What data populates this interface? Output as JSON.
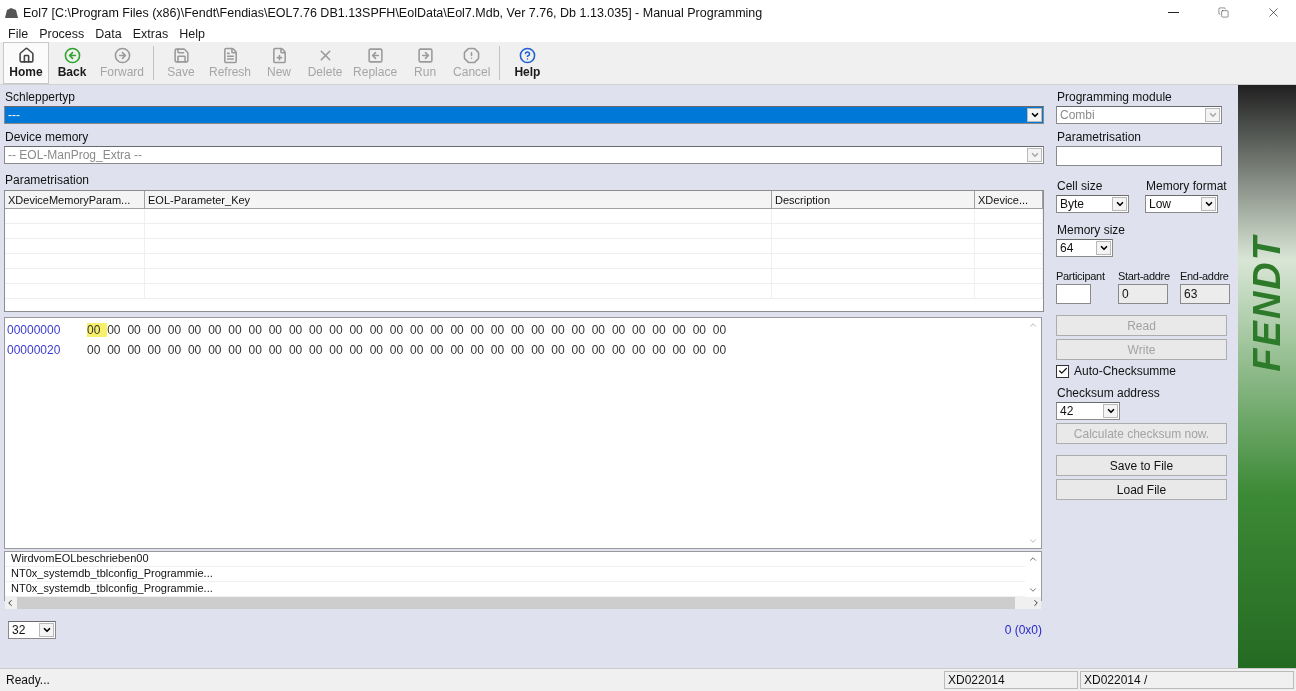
{
  "window": {
    "title": "Eol7 [C:\\Program Files (x86)\\Fendt\\Fendias\\EOL7.76 DB1.13SPFH\\EolData\\Eol7.Mdb, Ver 7.76, Db 1.13.035]  - Manual Programming"
  },
  "menu": [
    "File",
    "Process",
    "Data",
    "Extras",
    "Help"
  ],
  "toolbar": {
    "groups": [
      {
        "buttons": [
          {
            "label": "Home",
            "kind": "home",
            "disabled": false,
            "selected": true
          },
          {
            "label": "Back",
            "kind": "back",
            "disabled": false,
            "selected": false
          },
          {
            "label": "Forward",
            "kind": "forward",
            "disabled": true,
            "selected": false
          }
        ]
      },
      {
        "buttons": [
          {
            "label": "Save",
            "kind": "save",
            "disabled": true,
            "selected": false
          },
          {
            "label": "Refresh",
            "kind": "refresh",
            "disabled": true,
            "selected": false
          },
          {
            "label": "New",
            "kind": "new",
            "disabled": true,
            "selected": false
          },
          {
            "label": "Delete",
            "kind": "delete",
            "disabled": true,
            "selected": false
          },
          {
            "label": "Replace",
            "kind": "replace",
            "disabled": true,
            "selected": false
          },
          {
            "label": "Run",
            "kind": "run",
            "disabled": true,
            "selected": false
          },
          {
            "label": "Cancel",
            "kind": "cancel",
            "disabled": true,
            "selected": false
          }
        ]
      },
      {
        "buttons": [
          {
            "label": "Help",
            "kind": "help",
            "disabled": false,
            "selected": false
          }
        ]
      }
    ]
  },
  "schleppertyp": {
    "label": "Schleppertyp",
    "value": "---",
    "selected": true
  },
  "device_memory": {
    "label": "Device memory",
    "value": "-- EOL-ManProg_Extra --",
    "disabled": true
  },
  "parametrisation": {
    "label": "Parametrisation",
    "columns": [
      "XDeviceMemoryParam...",
      "EOL-Parameter_Key",
      "Description",
      "XDevice..."
    ]
  },
  "hex_rows": [
    {
      "address": "00000000",
      "bytes": [
        {
          "value": "00",
          "selected": true
        },
        {
          "value": "00",
          "selected": false
        },
        {
          "value": "00",
          "selected": false
        },
        {
          "value": "00",
          "selected": false
        },
        {
          "value": "00",
          "selected": false
        },
        {
          "value": "00",
          "selected": false
        },
        {
          "value": "00",
          "selected": false
        },
        {
          "value": "00",
          "selected": false
        },
        {
          "value": "00",
          "selected": false
        },
        {
          "value": "00",
          "selected": false
        },
        {
          "value": "00",
          "selected": false
        },
        {
          "value": "00",
          "selected": false
        },
        {
          "value": "00",
          "selected": false
        },
        {
          "value": "00",
          "selected": false
        },
        {
          "value": "00",
          "selected": false
        },
        {
          "value": "00",
          "selected": false
        },
        {
          "value": "00",
          "selected": false
        },
        {
          "value": "00",
          "selected": false
        },
        {
          "value": "00",
          "selected": false
        },
        {
          "value": "00",
          "selected": false
        },
        {
          "value": "00",
          "selected": false
        },
        {
          "value": "00",
          "selected": false
        },
        {
          "value": "00",
          "selected": false
        },
        {
          "value": "00",
          "selected": false
        },
        {
          "value": "00",
          "selected": false
        },
        {
          "value": "00",
          "selected": false
        },
        {
          "value": "00",
          "selected": false
        },
        {
          "value": "00",
          "selected": false
        },
        {
          "value": "00",
          "selected": false
        },
        {
          "value": "00",
          "selected": false
        },
        {
          "value": "00",
          "selected": false
        },
        {
          "value": "00",
          "selected": false
        }
      ]
    },
    {
      "address": "00000020",
      "bytes": [
        {
          "value": "00",
          "selected": false
        },
        {
          "value": "00",
          "selected": false
        },
        {
          "value": "00",
          "selected": false
        },
        {
          "value": "00",
          "selected": false
        },
        {
          "value": "00",
          "selected": false
        },
        {
          "value": "00",
          "selected": false
        },
        {
          "value": "00",
          "selected": false
        },
        {
          "value": "00",
          "selected": false
        },
        {
          "value": "00",
          "selected": false
        },
        {
          "value": "00",
          "selected": false
        },
        {
          "value": "00",
          "selected": false
        },
        {
          "value": "00",
          "selected": false
        },
        {
          "value": "00",
          "selected": false
        },
        {
          "value": "00",
          "selected": false
        },
        {
          "value": "00",
          "selected": false
        },
        {
          "value": "00",
          "selected": false
        },
        {
          "value": "00",
          "selected": false
        },
        {
          "value": "00",
          "selected": false
        },
        {
          "value": "00",
          "selected": false
        },
        {
          "value": "00",
          "selected": false
        },
        {
          "value": "00",
          "selected": false
        },
        {
          "value": "00",
          "selected": false
        },
        {
          "value": "00",
          "selected": false
        },
        {
          "value": "00",
          "selected": false
        },
        {
          "value": "00",
          "selected": false
        },
        {
          "value": "00",
          "selected": false
        },
        {
          "value": "00",
          "selected": false
        },
        {
          "value": "00",
          "selected": false
        },
        {
          "value": "00",
          "selected": false
        },
        {
          "value": "00",
          "selected": false
        },
        {
          "value": "00",
          "selected": false
        },
        {
          "value": "00",
          "selected": false
        }
      ]
    }
  ],
  "log_items": [
    "WirdvomEOLbeschrieben00",
    "NT0x_systemdb_tblconfig_Programmie...",
    "NT0x_systemdb_tblconfig_Programmie..."
  ],
  "page_size": "32",
  "offset": "0 (0x0)",
  "side": {
    "programming_module": {
      "label": "Programming module",
      "value": "Combi",
      "disabled": true
    },
    "parametrisation": {
      "label": "Parametrisation"
    },
    "cell_size": {
      "label": "Cell size",
      "value": "Byte"
    },
    "memory_format": {
      "label": "Memory format",
      "value": "Low"
    },
    "memory_size": {
      "label": "Memory size",
      "value": "64"
    },
    "participant": {
      "label": "Participant"
    },
    "start_address": {
      "label": "Start-addre",
      "value": "0"
    },
    "end_address": {
      "label": "End-addre",
      "value": "63"
    },
    "read": {
      "label": "Read",
      "disabled": true
    },
    "write": {
      "label": "Write",
      "disabled": true
    },
    "auto_checksum": {
      "label": "Auto-Checksumme",
      "checked": true
    },
    "checksum_address": {
      "label": "Checksum address",
      "value": "42"
    },
    "calculate": {
      "label": "Calculate checksum now.",
      "disabled": true
    },
    "save_file": {
      "label": "Save to File",
      "disabled": false
    },
    "load_file": {
      "label": "Load File",
      "disabled": false
    }
  },
  "brand": {
    "logo_text": "FENDT"
  },
  "status_bar": [
    "Ready...",
    "XD022014",
    "XD022014 /"
  ]
}
